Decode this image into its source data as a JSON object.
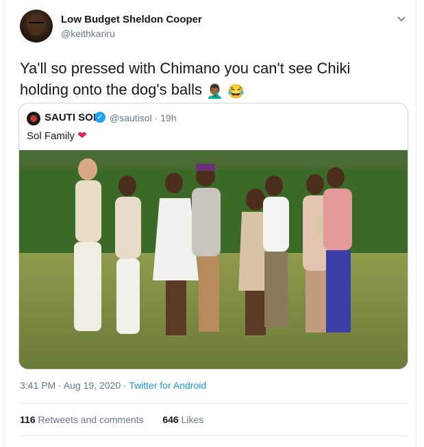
{
  "tweet": {
    "author_name": "Low Budget Sheldon Cooper",
    "author_handle": "@keithkariru",
    "text": "Ya'll so pressed with Chimano you can't see Chiki holding onto the dog's balls",
    "emojis": [
      "🤦🏾‍♂️",
      "😂"
    ],
    "timestamp": "3:41 PM · Aug 19, 2020 · ",
    "source": "Twitter for Android"
  },
  "quote": {
    "author_name": "SAUTI SOL",
    "author_handle": "@sautisol · 19h",
    "text": "Sol Family",
    "heart": "❤"
  },
  "stats": {
    "retweets_count": "116",
    "retweets_label": "Retweets and comments",
    "likes_count": "646",
    "likes_label": "Likes"
  },
  "icons": {
    "menu": "chevron-down-icon",
    "verified": "verified-badge-icon"
  },
  "colors": {
    "accent": "#1da1f2",
    "link": "#1b95e0",
    "muted": "#657786",
    "heart": "#e0245e"
  }
}
